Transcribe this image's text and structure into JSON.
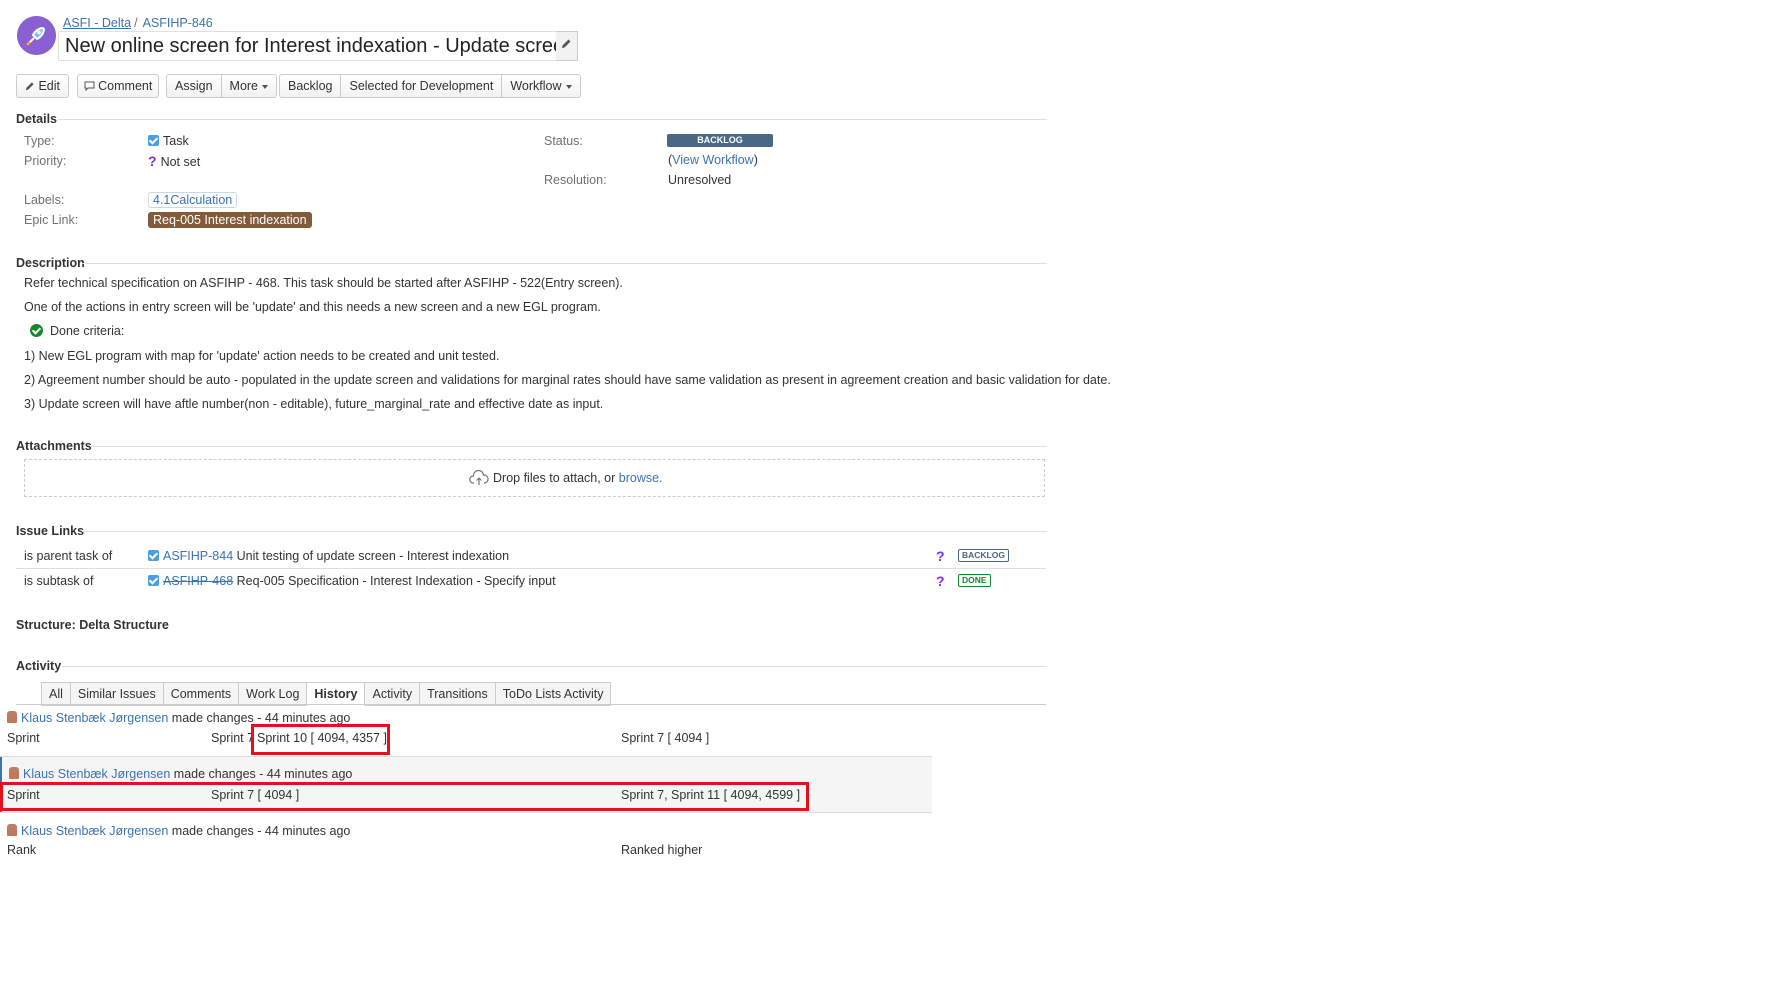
{
  "header": {
    "project_name": "ASFI - Delta",
    "issue_key": "ASFIHP-846",
    "summary": "New online screen for Interest indexation - Update screen",
    "project_avatar_icon": "rocket-icon"
  },
  "toolbar": {
    "edit": "Edit",
    "comment": "Comment",
    "assign": "Assign",
    "more": "More",
    "backlog": "Backlog",
    "selected_for_development": "Selected for Development",
    "workflow": "Workflow"
  },
  "details": {
    "heading": "Details",
    "type_label": "Type:",
    "type_value": "Task",
    "priority_label": "Priority:",
    "priority_value": "Not set",
    "labels_label": "Labels:",
    "labels_value": "4.1Calculation",
    "epic_label": "Epic Link:",
    "epic_value": "Req-005 Interest indexation",
    "status_label": "Status:",
    "status_value": "BACKLOG",
    "view_workflow_open": "(",
    "view_workflow": "View Workflow",
    "view_workflow_close": ")",
    "resolution_label": "Resolution:",
    "resolution_value": "Unresolved",
    "colors": {
      "status": "#4a6785",
      "epic": "#815b3a"
    }
  },
  "description": {
    "heading": "Description",
    "lines": [
      "Refer technical specification on ASFIHP - 468. This task should be started after ASFIHP - 522(Entry screen).",
      "One of the actions in entry screen will be 'update' and this needs a new screen and a new EGL program.",
      "Done criteria:",
      " 1) New EGL program with map for 'update' action needs to be created and unit tested.",
      "2) Agreement number should be auto - populated in the update screen and validations for marginal rates should have same validation as present in agreement creation and basic validation for date.",
      "3) Update screen will have aftle number(non - editable), future_marginal_rate and effective date as input."
    ]
  },
  "attachments": {
    "heading": "Attachments",
    "drop_text": "Drop files to attach, or ",
    "browse": "browse."
  },
  "issue_links": {
    "heading": "Issue Links",
    "rows": [
      {
        "relation": "is parent task of",
        "key": "ASFIHP-844",
        "summary": "Unit testing of update screen - Interest indexation",
        "status": "BACKLOG"
      },
      {
        "relation": "is subtask of",
        "key": "ASFIHP-468",
        "summary": "Req-005 Specification - Interest Indexation - Specify input",
        "status": "DONE"
      }
    ]
  },
  "structure": {
    "heading": "Structure: Delta Structure"
  },
  "activity": {
    "heading": "Activity",
    "tabs": [
      "All",
      "Similar Issues",
      "Comments",
      "Work Log",
      "History",
      "Activity",
      "Transitions",
      "ToDo Lists Activity"
    ],
    "active_tab": "History",
    "history": [
      {
        "author": "Klaus Stenbæk Jørgensen",
        "action": " made changes - 44 minutes ago",
        "field": "Sprint",
        "old": "Sprint 7",
        "new_inline": "Sprint 10 [ 4094, 4357 ]",
        "new": "Sprint 7 [ 4094 ]"
      },
      {
        "author": "Klaus Stenbæk Jørgensen",
        "action": " made changes - 44 minutes ago",
        "field": "Sprint",
        "old": "Sprint 7 [ 4094 ]",
        "new": "Sprint 7, Sprint 11 [ 4094, 4599 ]"
      },
      {
        "author": "Klaus Stenbæk Jørgensen",
        "action": " made changes - 44 minutes ago",
        "field": "Rank",
        "old": "",
        "new": "Ranked higher"
      }
    ]
  }
}
